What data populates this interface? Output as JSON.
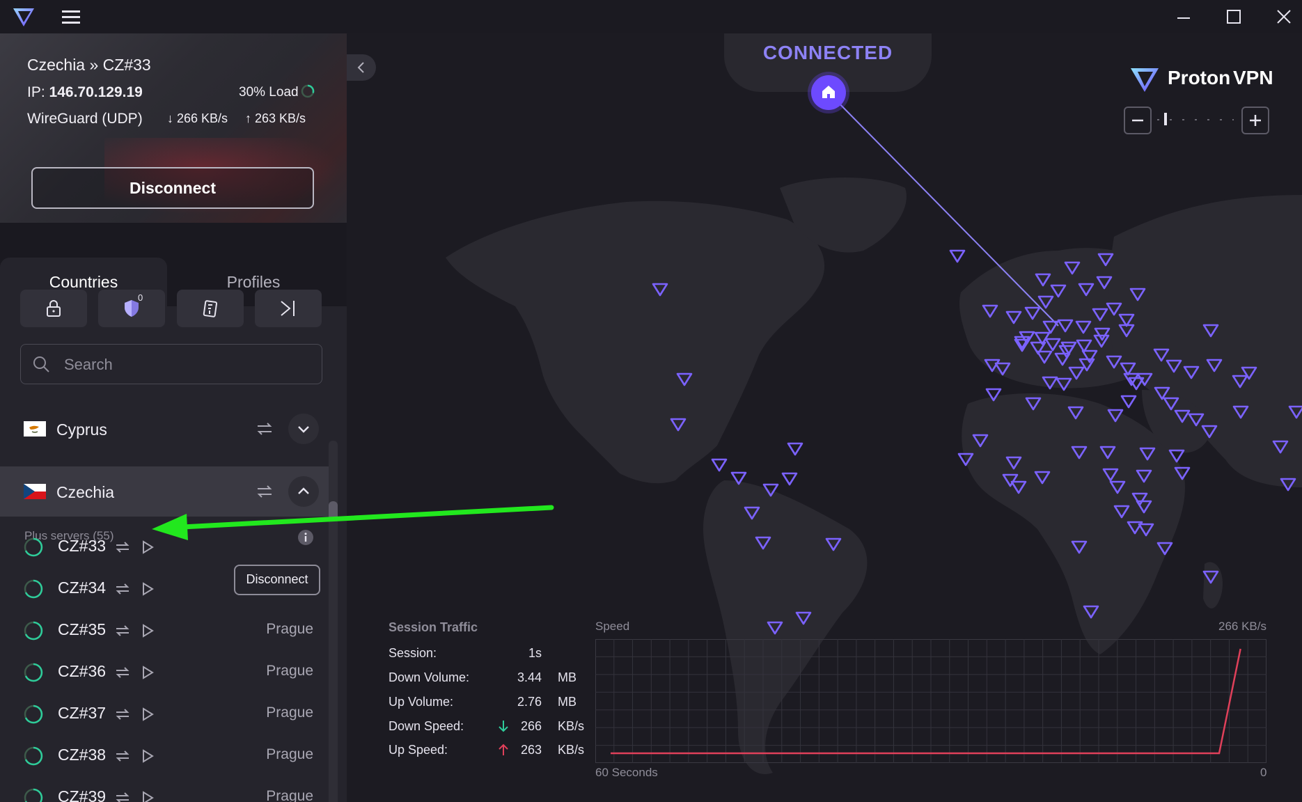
{
  "window": {
    "menu_icon": "hamburger-icon",
    "controls": [
      "minimize-icon",
      "maximize-icon",
      "close-icon"
    ]
  },
  "connection": {
    "server_path": "Czechia » CZ#33",
    "ip_label": "IP:",
    "ip": "146.70.129.19",
    "load": "30% Load",
    "protocol": "WireGuard (UDP)",
    "download": "266 KB/s",
    "upload": "263 KB/s",
    "disconnect_label": "Disconnect"
  },
  "tabs": [
    {
      "label": "Countries",
      "active": true
    },
    {
      "label": "Profiles",
      "active": false
    }
  ],
  "filters": {
    "icons": [
      "lock-icon",
      "p2p-shield-icon",
      "tor-icon",
      "streaming-icon"
    ],
    "p2p_count": "0"
  },
  "search": {
    "placeholder": "Search",
    "value": ""
  },
  "countries": [
    {
      "name": "Cyprus",
      "expanded": false
    },
    {
      "name": "Czechia",
      "expanded": true
    }
  ],
  "plus_servers_label": "Plus servers (55)",
  "servers": [
    {
      "name": "CZ#33",
      "city": "",
      "action": "Disconnect",
      "connected": true
    },
    {
      "name": "CZ#34",
      "city": "Prague"
    },
    {
      "name": "CZ#35",
      "city": "Prague"
    },
    {
      "name": "CZ#36",
      "city": "Prague"
    },
    {
      "name": "CZ#37",
      "city": "Prague"
    },
    {
      "name": "CZ#38",
      "city": "Prague"
    },
    {
      "name": "CZ#39",
      "city": "Prague"
    }
  ],
  "map": {
    "status": "CONNECTED",
    "brand_proton": "Proton",
    "brand_vpn": "VPN",
    "accent_color": "#8d82f5",
    "pin_color": "#6d4aff"
  },
  "session_traffic": {
    "title": "Session Traffic",
    "rows": [
      {
        "label": "Session:",
        "value": "1s",
        "unit": ""
      },
      {
        "label": "Down Volume:",
        "value": "3.44",
        "unit": "MB"
      },
      {
        "label": "Up Volume:",
        "value": "2.76",
        "unit": "MB"
      },
      {
        "label": "Down Speed:",
        "value": "266",
        "unit": "KB/s"
      },
      {
        "label": "Up Speed:",
        "value": "263",
        "unit": "KB/s"
      }
    ]
  },
  "speed_chart": {
    "label": "Speed",
    "max_label": "266 KB/s",
    "x_left": "60 Seconds",
    "x_right": "0",
    "line_color": "#e0405a"
  },
  "chart_data": {
    "type": "line",
    "title": "",
    "xlabel": "",
    "ylabel": "Speed",
    "x_range": [
      60,
      0
    ],
    "ylim": [
      0,
      266
    ],
    "series": [
      {
        "x": [
          60,
          3,
          1
        ],
        "values": [
          0,
          0,
          266
        ]
      }
    ]
  }
}
